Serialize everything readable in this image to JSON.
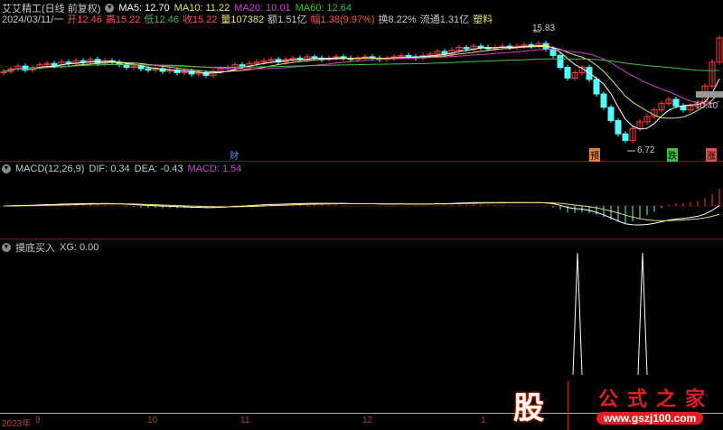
{
  "header": {
    "title": "艾艾精工(日线 前复权)",
    "ma5": "MA5: 12.70",
    "ma10": "MA10: 11.22",
    "ma20": "MA20: 10.01",
    "ma60": "MA60: 12.64",
    "date": "2024/03/11/一",
    "open": "开12.46",
    "high": "高15.22",
    "low": "低12.46",
    "close": "收15.22",
    "volume": "量107382",
    "amount": "额1.51亿",
    "change": "幅1.38(9.97%)",
    "turnover": "换8.22%",
    "float": "流通1.31亿",
    "sector": "塑料"
  },
  "macd_header": {
    "title": "MACD(12,26,9)",
    "dif": "DIF: 0.34",
    "dea": "DEA: -0.43",
    "macd": "MACD: 1.54"
  },
  "xg_header": {
    "title": "摸底买入",
    "xg": "XG: 0.00"
  },
  "axis": {
    "year": "2023年",
    "months": [
      "9",
      "10",
      "11",
      "12",
      "1"
    ]
  },
  "markers": {
    "cai": "财",
    "yu": "预",
    "die": "跌",
    "zhang": "涨",
    "max": "15.83",
    "min": "6.72",
    "right": "10.40"
  },
  "logo": {
    "char": "股",
    "name": "公式之家",
    "url": "www.gszj100.com"
  },
  "colors": {
    "up": "#ff3c3c",
    "down": "#54fcfc",
    "ma5": "#ffffff",
    "ma10": "#e8e070",
    "ma20": "#d040d0",
    "ma60": "#40c040"
  },
  "chart_data": {
    "type": "candlestick",
    "price_range": [
      6.72,
      15.83
    ],
    "closes": [
      12.7,
      12.9,
      13.1,
      12.8,
      13.0,
      13.2,
      13.3,
      13.1,
      13.4,
      13.3,
      13.5,
      13.4,
      13.6,
      13.3,
      13.5,
      13.4,
      13.2,
      13.0,
      13.1,
      12.9,
      12.8,
      12.9,
      12.7,
      12.8,
      12.6,
      12.7,
      12.5,
      12.6,
      12.4,
      12.7,
      12.9,
      13.0,
      13.2,
      13.1,
      13.3,
      13.4,
      13.5,
      13.6,
      13.4,
      13.6,
      13.7,
      13.6,
      13.8,
      13.7,
      13.6,
      13.7,
      13.8,
      13.7,
      13.6,
      13.7,
      13.8,
      13.7,
      13.6,
      13.7,
      13.8,
      13.9,
      13.8,
      13.7,
      13.9,
      14.0,
      14.2,
      14.0,
      14.3,
      14.5,
      14.4,
      14.6,
      14.5,
      14.4,
      14.5,
      14.6,
      14.5,
      14.6,
      14.7,
      14.6,
      14.8,
      14.4,
      13.9,
      13.0,
      12.2,
      12.6,
      13.0,
      12.1,
      11.0,
      10.0,
      9.0,
      8.0,
      7.5,
      8.4,
      8.9,
      9.3,
      9.8,
      10.3,
      10.6,
      10.1,
      9.8,
      10.1,
      10.4,
      11.6,
      13.4,
      15.22
    ],
    "xg_signal_indices": [
      79,
      88
    ]
  }
}
